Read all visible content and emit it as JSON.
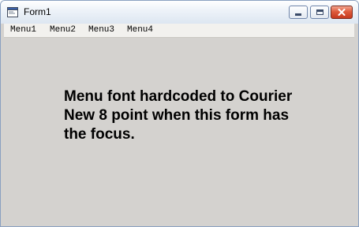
{
  "window": {
    "title": "Form1",
    "controls": {
      "minimize": "minimize",
      "maximize": "maximize",
      "close": "close"
    }
  },
  "menu": {
    "items": [
      "Menu1",
      "Menu2",
      "Menu3",
      "Menu4"
    ]
  },
  "form": {
    "label_lines": [
      "Menu font hardcoded to Courier",
      "New 8 point when this form has",
      "the focus."
    ]
  },
  "colors": {
    "form_background": "#d4d2cf",
    "close_button": "#d84a2c",
    "title_bar": "#e7eef7"
  },
  "icons": {
    "app": "application-window-icon",
    "minimize": "minimize-icon",
    "maximize": "maximize-icon",
    "close": "close-icon"
  }
}
